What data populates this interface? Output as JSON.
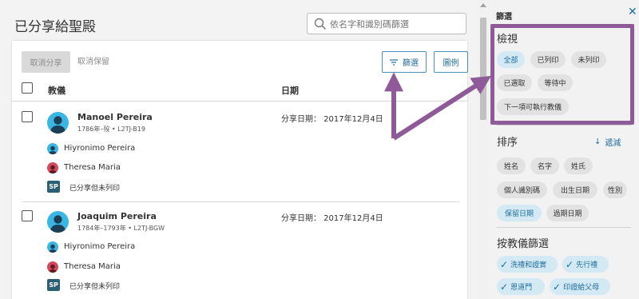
{
  "header": {
    "title": "已分享給聖殿",
    "search_placeholder": "依名字和識別碼篩選"
  },
  "toolbar": {
    "unshare_label": "取消分享",
    "unreserve_label": "取消保留",
    "filter_label": "篩選",
    "legend_label": "圖例"
  },
  "columns": {
    "ordinance": "教儀",
    "date": "日期"
  },
  "persons": [
    {
      "name": "Manoel Pereira",
      "meta": "1786年–歿 •  L2TJ-B19",
      "shared_date": "分享日期：  2017年12月4日",
      "relatives": [
        {
          "name": "Hiyronimo Pereira",
          "gender": "male"
        },
        {
          "name": "Theresa Maria",
          "gender": "female"
        }
      ],
      "status_badge": "SP",
      "status_text": "已分享但未列印"
    },
    {
      "name": "Joaquim Pereira",
      "meta": "1784年–1793年 •  L2TJ-BGW",
      "shared_date": "分享日期：  2017年12月4日",
      "relatives": [
        {
          "name": "Hiyronimo Pereira",
          "gender": "male"
        },
        {
          "name": "Theresa Maria",
          "gender": "female"
        }
      ],
      "status_badge": "SP",
      "status_text": "已分享但未列印"
    }
  ],
  "panel": {
    "title": "篩選",
    "view": {
      "title": "檢視",
      "chips": [
        "全部",
        "已列印",
        "未列印",
        "已選取",
        "等待中",
        "下一項可執行教儀"
      ],
      "active_index": 0
    },
    "sort": {
      "title": "排序",
      "reverse_label": "遞減",
      "chips": [
        "姓名",
        "名字",
        "姓氏",
        "個人識別碼",
        "出生日期",
        "性別",
        "保留日期",
        "過期日期"
      ],
      "active_index": 6
    },
    "ordinance_filter": {
      "title": "按教儀篩選",
      "chips": [
        "洗禮和證實",
        "先行禮",
        "恩道門",
        "印證給父母"
      ]
    }
  },
  "colors": {
    "accent": "#1f6d9c",
    "annotation": "#8e5b98",
    "avatar_male": "#3ab6e4",
    "avatar_female": "#d4495b",
    "badge": "#2b5f76"
  }
}
